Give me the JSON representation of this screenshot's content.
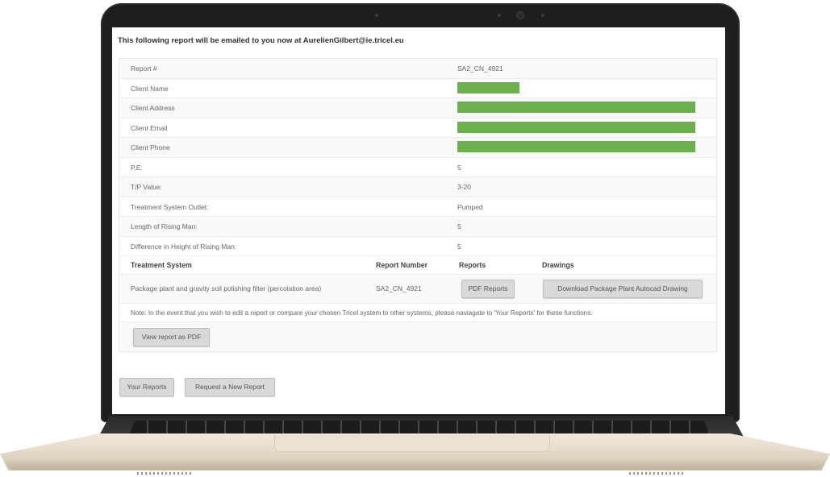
{
  "notice": "This following report will be emailed to you now at AurelienGilbert@ie.tricel.eu",
  "details": [
    {
      "label": "Report #",
      "value": "SA2_CN_4921"
    },
    {
      "label": "Client Name",
      "value": ""
    },
    {
      "label": "Client Address",
      "value": ""
    },
    {
      "label": "Client Email",
      "value": ""
    },
    {
      "label": "Client Phone",
      "value": ""
    },
    {
      "label": "P.E:",
      "value": "5"
    },
    {
      "label": "T/P Value:",
      "value": "3-20"
    },
    {
      "label": "Treatment System Outlet:",
      "value": "Pumped"
    },
    {
      "label": "Length of Rising Man:",
      "value": "5"
    },
    {
      "label": "Difference in Height of Rising Man:",
      "value": "5"
    }
  ],
  "system_table": {
    "headers": {
      "system": "Treatment System",
      "number": "Report Number",
      "reports": "Reports",
      "drawings": "Drawings"
    },
    "row": {
      "system": "Package plant and gravity soil polishing filter (percolation area)",
      "number": "SA2_CN_4921",
      "reports_button": "PDF Reports",
      "drawings_button": "Download Package Plant Autocad Drawing"
    }
  },
  "note": "Note: In the event that you wish to edit a report or compare your chosen Tricel system to other systems, please naviagate to 'Your Reports' for these functions.",
  "view_pdf_button": "View report as PDF",
  "footer_buttons": {
    "your_reports": "Your Reports",
    "request_new": "Request a New Report"
  },
  "colors": {
    "redaction": "#6ab04c",
    "laptop_bezel": "#1e1e20",
    "laptop_body": "#e6dccb"
  }
}
